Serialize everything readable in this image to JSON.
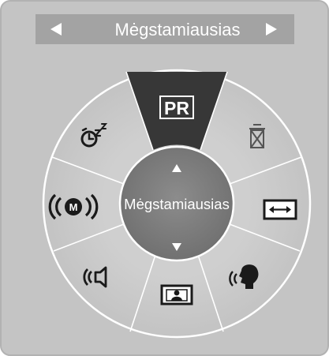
{
  "header": {
    "title": "Mėgstamiausias",
    "prev_arrow": "triangle-left-icon",
    "next_arrow": "triangle-right-icon"
  },
  "center": {
    "label": "Mėgstamiausias",
    "up_arrow": "triangle-up-icon",
    "down_arrow": "triangle-down-icon"
  },
  "wheel": {
    "selected": "pr",
    "items": [
      {
        "id": "pr",
        "label": "PR",
        "icon": "program-list-icon",
        "selected": true
      },
      {
        "id": "sleep",
        "icon": "sleep-timer-icon"
      },
      {
        "id": "delete",
        "icon": "delete-trash-icon"
      },
      {
        "id": "mono",
        "icon": "mono-audio-icon"
      },
      {
        "id": "aspect",
        "icon": "aspect-ratio-icon"
      },
      {
        "id": "speaker",
        "icon": "tv-speaker-icon"
      },
      {
        "id": "voice",
        "icon": "clear-voice-icon"
      },
      {
        "id": "picture",
        "icon": "picture-mode-icon"
      }
    ]
  },
  "colors": {
    "panel": "#c4c4c4",
    "header_bar": "#a3a3a3",
    "wheel_ring": "#c9c9c9",
    "selected_segment": "#373737",
    "center_hub": "#7c7c7c",
    "icon": "#1a1a1a",
    "text": "#ffffff"
  }
}
